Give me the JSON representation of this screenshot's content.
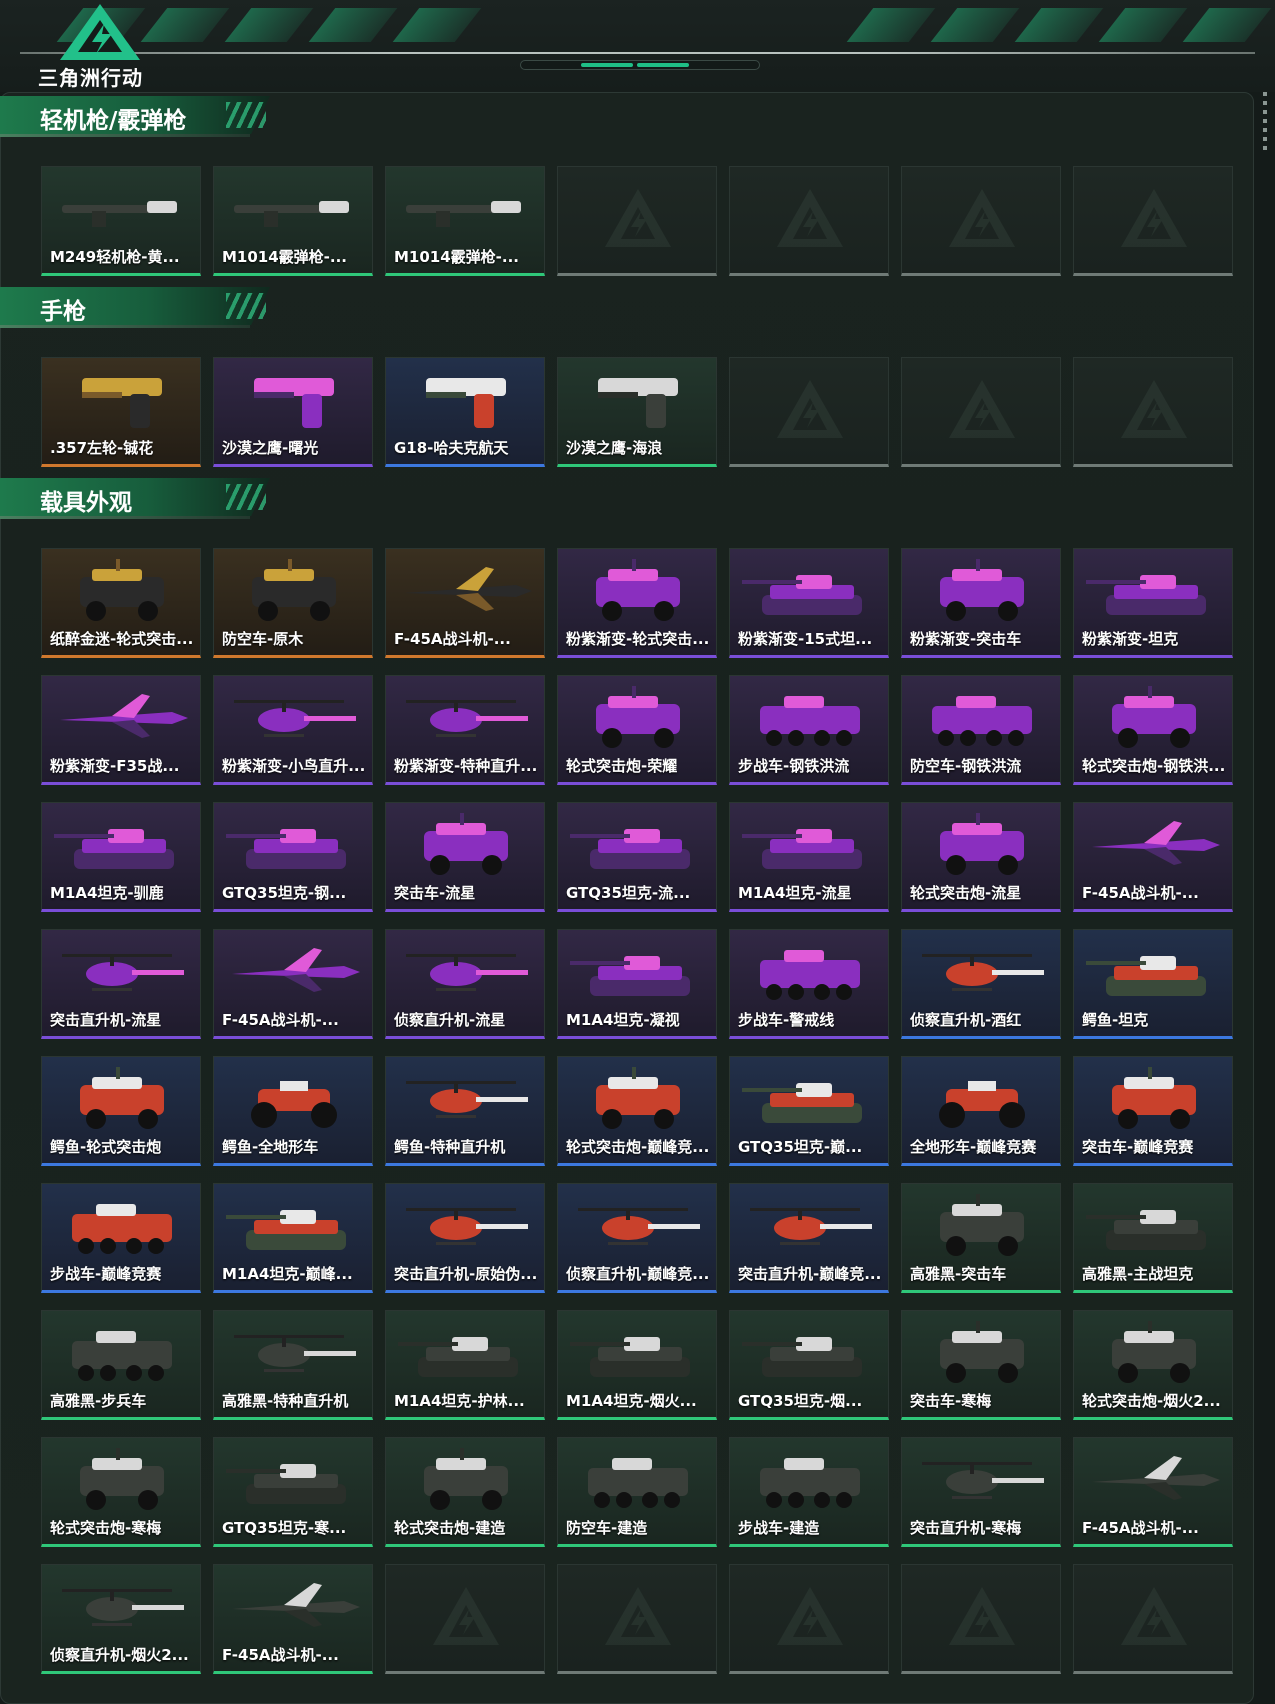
{
  "app": {
    "logo_text": "三角洲行动",
    "accent": "#1fbf86"
  },
  "sections": [
    {
      "title": "轻机枪/霰弹枪",
      "items": [
        {
          "label": "M249轻机枪-黄...",
          "rarity": "green",
          "kind": "gun"
        },
        {
          "label": "M1014霰弹枪-...",
          "rarity": "green",
          "kind": "gun"
        },
        {
          "label": "M1014霰弹枪-...",
          "rarity": "green",
          "kind": "gun"
        },
        {
          "label": "",
          "rarity": "empty",
          "kind": "empty"
        },
        {
          "label": "",
          "rarity": "empty",
          "kind": "empty"
        },
        {
          "label": "",
          "rarity": "empty",
          "kind": "empty"
        },
        {
          "label": "",
          "rarity": "empty",
          "kind": "empty"
        }
      ]
    },
    {
      "title": "手枪",
      "items": [
        {
          "label": ".357左轮-铖花",
          "rarity": "gold",
          "kind": "pistol"
        },
        {
          "label": "沙漠之鹰-曙光",
          "rarity": "purple",
          "kind": "pistol"
        },
        {
          "label": "G18-哈夫克航天",
          "rarity": "blue",
          "kind": "pistol"
        },
        {
          "label": "沙漠之鹰-海浪",
          "rarity": "green",
          "kind": "pistol"
        },
        {
          "label": "",
          "rarity": "empty",
          "kind": "empty"
        },
        {
          "label": "",
          "rarity": "empty",
          "kind": "empty"
        },
        {
          "label": "",
          "rarity": "empty",
          "kind": "empty"
        }
      ]
    },
    {
      "title": "载具外观",
      "items": [
        {
          "label": "纸醉金迷-轮式突击...",
          "rarity": "gold",
          "kind": "car"
        },
        {
          "label": "防空车-原木",
          "rarity": "gold",
          "kind": "car"
        },
        {
          "label": "F-45A战斗机-...",
          "rarity": "gold",
          "kind": "jet"
        },
        {
          "label": "粉紫渐变-轮式突击...",
          "rarity": "purple",
          "kind": "car"
        },
        {
          "label": "粉紫渐变-15式坦...",
          "rarity": "purple",
          "kind": "tank"
        },
        {
          "label": "粉紫渐变-突击车",
          "rarity": "purple",
          "kind": "car"
        },
        {
          "label": "粉紫渐变-坦克",
          "rarity": "purple",
          "kind": "tank"
        },
        {
          "label": "粉紫渐变-F35战...",
          "rarity": "purple",
          "kind": "jet"
        },
        {
          "label": "粉紫渐变-小鸟直升...",
          "rarity": "purple",
          "kind": "heli"
        },
        {
          "label": "粉紫渐变-特种直升...",
          "rarity": "purple",
          "kind": "heli"
        },
        {
          "label": "轮式突击炮-荣耀",
          "rarity": "purple",
          "kind": "car"
        },
        {
          "label": "步战车-钢铁洪流",
          "rarity": "purple",
          "kind": "apc"
        },
        {
          "label": "防空车-钢铁洪流",
          "rarity": "purple",
          "kind": "apc"
        },
        {
          "label": "轮式突击炮-钢铁洪...",
          "rarity": "purple",
          "kind": "car"
        },
        {
          "label": "M1A4坦克-驯鹿",
          "rarity": "purple",
          "kind": "tank"
        },
        {
          "label": "GTQ35坦克-钢...",
          "rarity": "purple",
          "kind": "tank"
        },
        {
          "label": "突击车-流星",
          "rarity": "purple",
          "kind": "car"
        },
        {
          "label": "GTQ35坦克-流...",
          "rarity": "purple",
          "kind": "tank"
        },
        {
          "label": "M1A4坦克-流星",
          "rarity": "purple",
          "kind": "tank"
        },
        {
          "label": "轮式突击炮-流星",
          "rarity": "purple",
          "kind": "car"
        },
        {
          "label": "F-45A战斗机-...",
          "rarity": "purple",
          "kind": "jet"
        },
        {
          "label": "突击直升机-流星",
          "rarity": "purple",
          "kind": "heli"
        },
        {
          "label": "F-45A战斗机-...",
          "rarity": "purple",
          "kind": "jet"
        },
        {
          "label": "侦察直升机-流星",
          "rarity": "purple",
          "kind": "heli"
        },
        {
          "label": "M1A4坦克-凝视",
          "rarity": "purple",
          "kind": "tank"
        },
        {
          "label": "步战车-警戒线",
          "rarity": "purple",
          "kind": "apc"
        },
        {
          "label": "侦察直升机-酒红",
          "rarity": "blue",
          "kind": "heli"
        },
        {
          "label": "鳄鱼-坦克",
          "rarity": "blue",
          "kind": "tank"
        },
        {
          "label": "鳄鱼-轮式突击炮",
          "rarity": "blue",
          "kind": "car"
        },
        {
          "label": "鳄鱼-全地形车",
          "rarity": "blue",
          "kind": "atv"
        },
        {
          "label": "鳄鱼-特种直升机",
          "rarity": "blue",
          "kind": "heli"
        },
        {
          "label": "轮式突击炮-巅峰竞...",
          "rarity": "blue",
          "kind": "car"
        },
        {
          "label": "GTQ35坦克-巅...",
          "rarity": "blue",
          "kind": "tank"
        },
        {
          "label": "全地形车-巅峰竞赛",
          "rarity": "blue",
          "kind": "atv"
        },
        {
          "label": "突击车-巅峰竞赛",
          "rarity": "blue",
          "kind": "car"
        },
        {
          "label": "步战车-巅峰竞赛",
          "rarity": "blue",
          "kind": "apc"
        },
        {
          "label": "M1A4坦克-巅峰...",
          "rarity": "blue",
          "kind": "tank"
        },
        {
          "label": "突击直升机-原始伪...",
          "rarity": "blue",
          "kind": "heli"
        },
        {
          "label": "侦察直升机-巅峰竞...",
          "rarity": "blue",
          "kind": "heli"
        },
        {
          "label": "突击直升机-巅峰竞...",
          "rarity": "blue",
          "kind": "heli"
        },
        {
          "label": "高雅黑-突击车",
          "rarity": "green",
          "kind": "car"
        },
        {
          "label": "高雅黑-主战坦克",
          "rarity": "green",
          "kind": "tank"
        },
        {
          "label": "高雅黑-步兵车",
          "rarity": "green",
          "kind": "apc"
        },
        {
          "label": "高雅黑-特种直升机",
          "rarity": "green",
          "kind": "heli"
        },
        {
          "label": "M1A4坦克-护林...",
          "rarity": "green",
          "kind": "tank"
        },
        {
          "label": "M1A4坦克-烟火...",
          "rarity": "green",
          "kind": "tank"
        },
        {
          "label": "GTQ35坦克-烟...",
          "rarity": "green",
          "kind": "tank"
        },
        {
          "label": "突击车-寒梅",
          "rarity": "green",
          "kind": "car"
        },
        {
          "label": "轮式突击炮-烟火2...",
          "rarity": "green",
          "kind": "car"
        },
        {
          "label": "轮式突击炮-寒梅",
          "rarity": "green",
          "kind": "car"
        },
        {
          "label": "GTQ35坦克-寒...",
          "rarity": "green",
          "kind": "tank"
        },
        {
          "label": "轮式突击炮-建造",
          "rarity": "green",
          "kind": "car"
        },
        {
          "label": "防空车-建造",
          "rarity": "green",
          "kind": "apc"
        },
        {
          "label": "步战车-建造",
          "rarity": "green",
          "kind": "apc"
        },
        {
          "label": "突击直升机-寒梅",
          "rarity": "green",
          "kind": "heli"
        },
        {
          "label": "F-45A战斗机-...",
          "rarity": "green",
          "kind": "jet"
        },
        {
          "label": "侦察直升机-烟火2...",
          "rarity": "green",
          "kind": "heli"
        },
        {
          "label": "F-45A战斗机-...",
          "rarity": "green",
          "kind": "jet"
        },
        {
          "label": "",
          "rarity": "empty",
          "kind": "empty"
        },
        {
          "label": "",
          "rarity": "empty",
          "kind": "empty"
        },
        {
          "label": "",
          "rarity": "empty",
          "kind": "empty"
        },
        {
          "label": "",
          "rarity": "empty",
          "kind": "empty"
        },
        {
          "label": "",
          "rarity": "empty",
          "kind": "empty"
        }
      ]
    }
  ]
}
